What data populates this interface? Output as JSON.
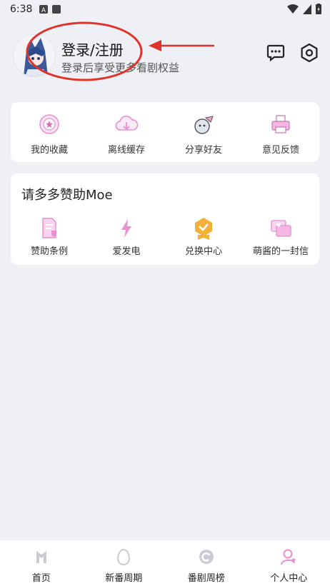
{
  "status_bar": {
    "time": "6:38"
  },
  "profile": {
    "login_title": "登录/注册",
    "login_subtitle": "登录后享受更多看剧权益"
  },
  "header_icons": [
    "chat-icon",
    "settings-icon"
  ],
  "quick_actions": [
    {
      "label": "我的收藏",
      "icon": "favorite-icon"
    },
    {
      "label": "离线缓存",
      "icon": "cloud-download-icon"
    },
    {
      "label": "分享好友",
      "icon": "share-icon"
    },
    {
      "label": "意见反馈",
      "icon": "feedback-icon"
    }
  ],
  "sponsor": {
    "title": "请多多赞助Moe",
    "items": [
      {
        "label": "赞助条例",
        "icon": "document-shield-icon"
      },
      {
        "label": "爱发电",
        "icon": "lightning-icon"
      },
      {
        "label": "兑换中心",
        "icon": "badge-icon"
      },
      {
        "label": "萌酱的一封信",
        "icon": "letter-icon"
      }
    ]
  },
  "bottom_nav": [
    {
      "label": "首页",
      "icon": "home-icon"
    },
    {
      "label": "新番周期",
      "icon": "egg-icon"
    },
    {
      "label": "番剧周榜",
      "icon": "ranking-icon"
    },
    {
      "label": "个人中心",
      "icon": "profile-icon",
      "active": true
    }
  ],
  "colors": {
    "background": "#eef0f5",
    "accent_pink": "#e88fd0",
    "annotation_red": "#e0342a",
    "badge_orange": "#f3b13a"
  }
}
